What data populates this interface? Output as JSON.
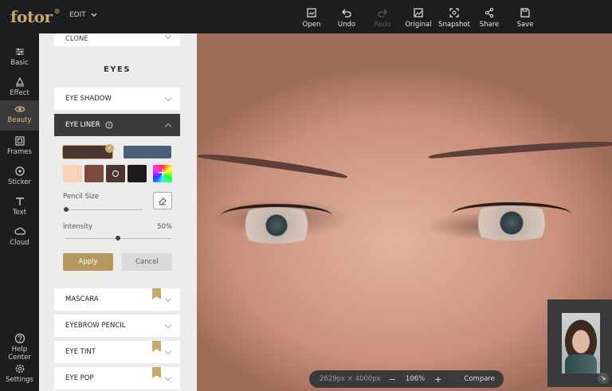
{
  "app": {
    "logo": "fotor",
    "logo_mark": "®",
    "mode": "EDIT"
  },
  "toolbar": [
    {
      "label": "Open",
      "icon": "open-icon",
      "enabled": true
    },
    {
      "label": "Undo",
      "icon": "undo-icon",
      "enabled": true
    },
    {
      "label": "Redo",
      "icon": "redo-icon",
      "enabled": false
    },
    {
      "label": "Original",
      "icon": "original-icon",
      "enabled": true
    },
    {
      "label": "Snapshot",
      "icon": "snapshot-icon",
      "enabled": true
    },
    {
      "label": "Share",
      "icon": "share-icon",
      "enabled": true
    },
    {
      "label": "Save",
      "icon": "save-icon",
      "enabled": true
    }
  ],
  "rail": [
    {
      "label": "Basic",
      "icon": "sliders-icon"
    },
    {
      "label": "Effect",
      "icon": "effect-icon"
    },
    {
      "label": "Beauty",
      "icon": "eye-icon",
      "active": true
    },
    {
      "label": "Frames",
      "icon": "frame-icon"
    },
    {
      "label": "Sticker",
      "icon": "sticker-icon"
    },
    {
      "label": "Text",
      "icon": "text-icon"
    },
    {
      "label": "Cloud",
      "icon": "cloud-icon"
    },
    {
      "label": "Help Center",
      "icon": "help-icon"
    },
    {
      "label": "Settings",
      "icon": "settings-icon"
    }
  ],
  "panel": {
    "prev_item": "CLONE",
    "section_title": "EYES",
    "eye_shadow": "EYE SHADOW",
    "eye_liner": "EYE LINER",
    "pencil_size_label": "Pencil Size",
    "intensity_label": "Intensity",
    "intensity_value": "50%",
    "intensity_fraction": 0.5,
    "pencil_size_fraction": 0.0,
    "apply": "Apply",
    "cancel": "Cancel",
    "mascara": "MASCARA",
    "eyebrow_pencil": "EYEBROW PENCIL",
    "eye_tint": "EYE TINT",
    "eye_pop": "EYE POP",
    "colors": {
      "selected_main": "#4a3530",
      "secondary": "#4a5e7a",
      "swatches": [
        "#f8d3b8",
        "#7a4a3f",
        "#4a3530",
        "#1e1a19"
      ],
      "accent": "#c9a86a"
    }
  },
  "status": {
    "dimensions": "2629px × 4000px",
    "zoom_out": "−",
    "zoom": "106%",
    "zoom_in": "+",
    "compare": "Compare"
  }
}
